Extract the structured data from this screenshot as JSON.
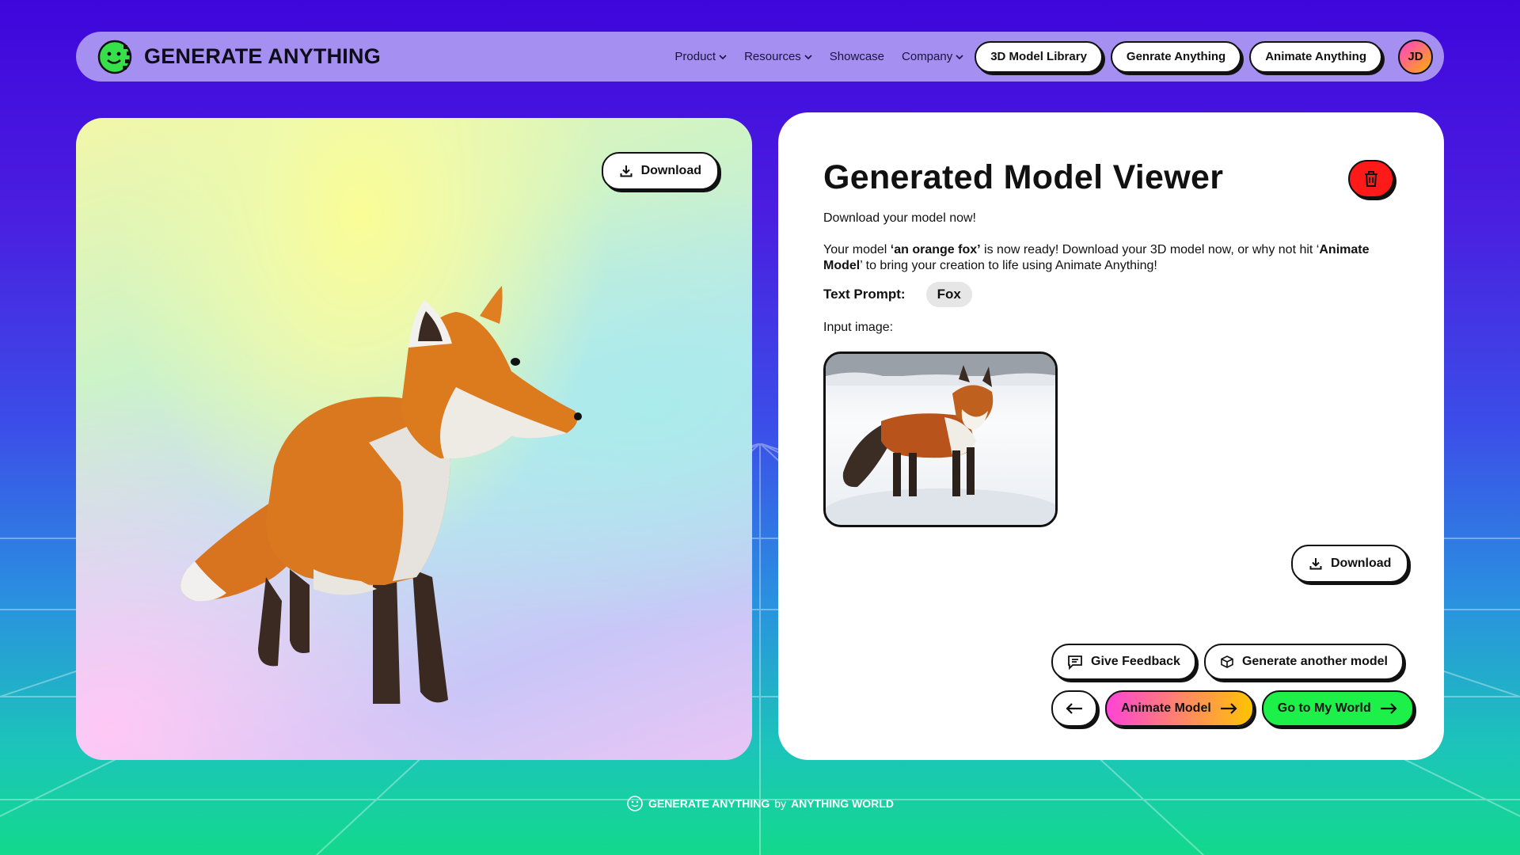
{
  "navbar": {
    "brand": "GENERATE ANYTHING",
    "menu": [
      {
        "label": "Product",
        "dropdown": true
      },
      {
        "label": "Resources",
        "dropdown": true
      },
      {
        "label": "Showcase",
        "dropdown": false
      },
      {
        "label": "Company",
        "dropdown": true
      }
    ],
    "buttons": [
      "3D Model Library",
      "Genrate Anything",
      "Animate Anything"
    ],
    "avatar_initials": "JD"
  },
  "viewer": {
    "download_label": "Download",
    "model_icon": "fox-3d-model"
  },
  "panel": {
    "title": "Generated Model Viewer",
    "subtitle": "Download your model now!",
    "para_pre": "Your model ",
    "model_name": "‘an orange fox’",
    "para_mid": " is now ready! Download your 3D model now, or why not hit ‘",
    "animate_bold": "Animate Model",
    "para_post": "’ to bring your creation to life using Animate Anything!",
    "prompt_label": "Text Prompt:",
    "prompt_value": "Fox",
    "input_label": "Input image:",
    "download_label": "Download",
    "feedback_label": "Give Feedback",
    "generate_label": "Generate another model",
    "animate_label": "Animate Model",
    "world_label": "Go to My World"
  },
  "footer": {
    "brand": "GENERATE ANYTHING",
    "by": "by",
    "company": "ANYTHING WORLD"
  },
  "colors": {
    "trash": "#ff1a1a",
    "world": "#1ef04a",
    "animate_from": "#ff44d6",
    "animate_to": "#ffc400",
    "nav_bg": "#a58ff0"
  }
}
